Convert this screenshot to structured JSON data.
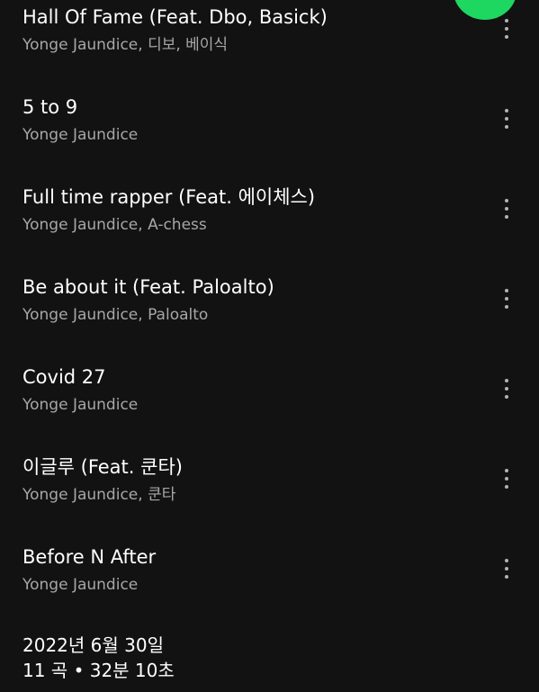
{
  "colors": {
    "background": "#121212",
    "accent": "#1ed760",
    "primary_text": "#ffffff",
    "secondary_text": "#a7a7a7"
  },
  "tracks": [
    {
      "title": "Hall Of Fame (Feat. Dbo, Basick)",
      "artists": "Yonge Jaundice, 디보, 베이식",
      "more_icon": "more-vertical-icon"
    },
    {
      "title": "5 to 9",
      "artists": "Yonge Jaundice",
      "more_icon": "more-vertical-icon"
    },
    {
      "title": "Full time rapper (Feat. 에이체스)",
      "artists": "Yonge Jaundice, A-chess",
      "more_icon": "more-vertical-icon"
    },
    {
      "title": "Be about it (Feat. Paloalto)",
      "artists": "Yonge Jaundice, Paloalto",
      "more_icon": "more-vertical-icon"
    },
    {
      "title": "Covid 27",
      "artists": "Yonge Jaundice",
      "more_icon": "more-vertical-icon"
    },
    {
      "title": "이글루 (Feat. 쿤타)",
      "artists": "Yonge Jaundice, 쿤타",
      "more_icon": "more-vertical-icon"
    },
    {
      "title": "Before N After",
      "artists": "Yonge Jaundice",
      "more_icon": "more-vertical-icon"
    }
  ],
  "album": {
    "release_date": "2022년 6월 30일",
    "summary": "11 곡 • 32분 10초"
  },
  "play_button": {
    "icon": "play-icon"
  }
}
